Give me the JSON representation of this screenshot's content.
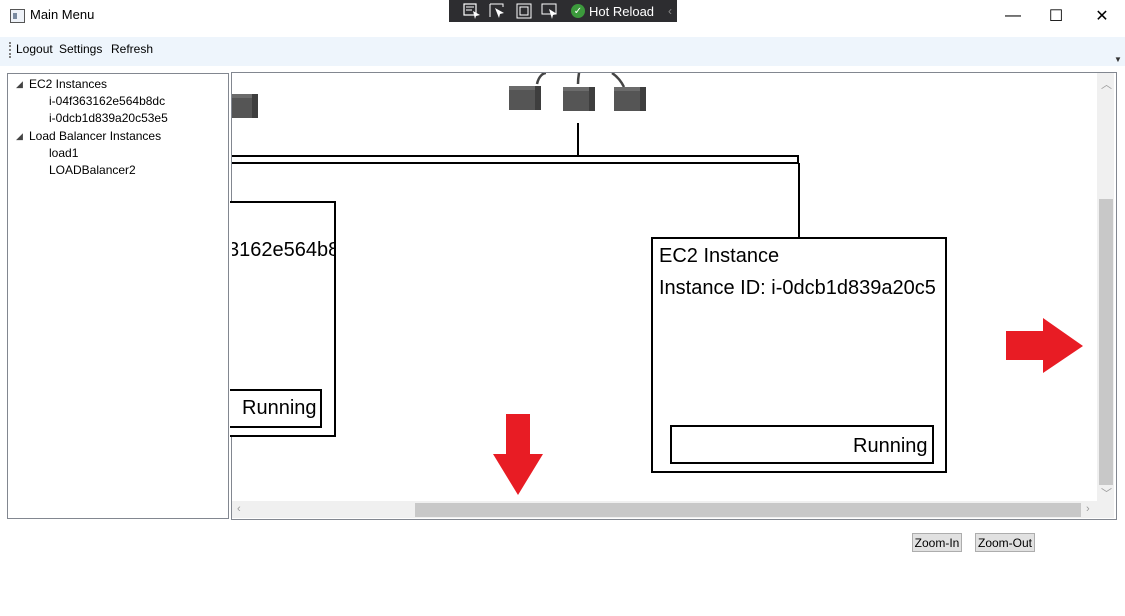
{
  "window": {
    "title": "Main Menu",
    "minimize_glyph": "—",
    "maximize_glyph": "☐",
    "close_glyph": "✕"
  },
  "hot_reload_toolbar": {
    "label": "Hot Reload",
    "icons": [
      "select-element-icon",
      "pointer-icon",
      "layout-adorner-icon",
      "track-focus-icon",
      "hot-reload-check-icon"
    ]
  },
  "menu": {
    "items": [
      "Logout",
      "Settings",
      "Refresh"
    ]
  },
  "tree": {
    "groups": [
      {
        "label": "EC2 Instances",
        "children": [
          "i-04f363162e564b8dc",
          "i-0dcb1d839a20c53e5"
        ]
      },
      {
        "label": "Load Balancer Instances",
        "children": [
          "load1",
          "LOADBalancer2"
        ]
      }
    ],
    "expand_glyph": "◢"
  },
  "canvas": {
    "left_card": {
      "id_fragment": "3162e564b8",
      "status": "Running"
    },
    "right_card": {
      "title": "EC2 Instance",
      "instance_id": "Instance ID: i-0dcb1d839a20c5",
      "status": "Running"
    },
    "arrow_color": "#e81c24",
    "icons": [
      "server-cube-icon",
      "server-cube-icon",
      "server-cube-icon",
      "server-cube-icon"
    ]
  },
  "buttons": {
    "zoom_in": "Zoom-In",
    "zoom_out": "Zoom-Out"
  }
}
